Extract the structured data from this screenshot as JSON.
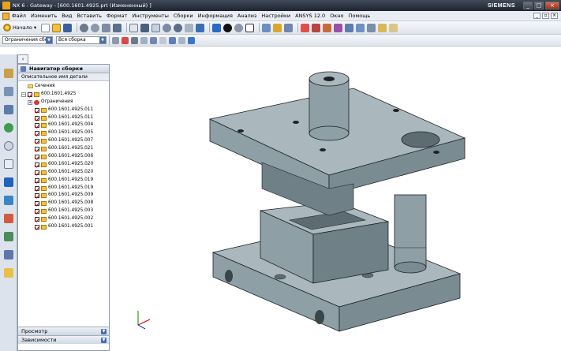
{
  "window": {
    "title": "NX 6 - Gateway - [600.1601.4925.prt (Измененный) ]",
    "brand": "SIEMENS"
  },
  "menu": {
    "items": [
      "Файл",
      "Изменить",
      "Вид",
      "Вставить",
      "Формат",
      "Инструменты",
      "Сборки",
      "Информация",
      "Анализ",
      "Настройки",
      "ANSYS 12.0",
      "Окно",
      "Помощь"
    ]
  },
  "toolbar": {
    "start_label": "Начало",
    "filter_select": "Ограничения сбор",
    "assembly_select": "Вся сборка"
  },
  "navigator": {
    "title": "Навигатор сборки",
    "column_header": "Описательное имя детали",
    "sections_label": "Сечения",
    "root_label": "600.1601.4925",
    "constraints_label": "Ограничения",
    "parts": [
      "600.1601.4925.011",
      "600.1601.4925.011",
      "600.1601.4925.004",
      "600.1601.4925.005",
      "600.1601.4925.007",
      "600.1601.4925.021",
      "600.1601.4925.006",
      "600.1601.4925.020",
      "600.1601.4925.020",
      "600.1601.4925.019",
      "600.1601.4925.019",
      "600.1601.4925.009",
      "600.1601.4925.008",
      "600.1601.4925.003",
      "600.1601.4925.002",
      "600.1601.4925.001"
    ],
    "preview_label": "Просмотр",
    "dependencies_label": "Зависимости"
  },
  "colors": {
    "model_body": "#8e9fa6",
    "model_top": "#aab8bd",
    "model_dark": "#5d6c73",
    "model_edge": "#1c2226",
    "titlebar": "#2b3340"
  },
  "icons": {
    "app": "nx-app-icon",
    "pin": "pin-icon",
    "part": "part-icon",
    "checkbox": "checkbox-icon"
  }
}
